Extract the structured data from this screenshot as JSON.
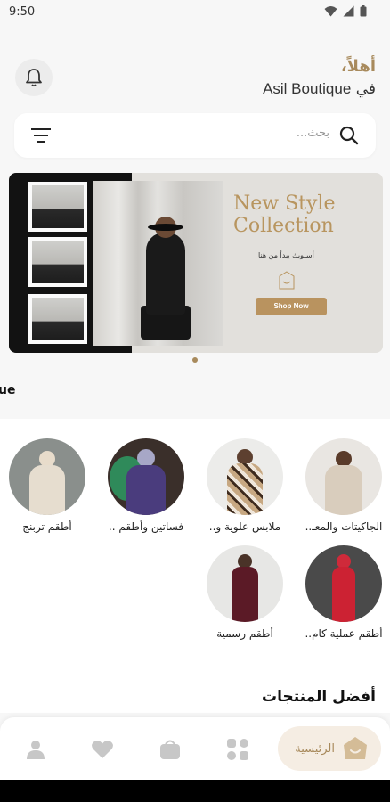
{
  "status_bar": {
    "time": "9:50"
  },
  "header": {
    "greeting": "أهلاً،",
    "boutique_prefix": "في",
    "boutique_name": "Asil Boutique"
  },
  "search": {
    "placeholder": "بحث..."
  },
  "banner": {
    "title_line1": "New Style",
    "title_line2": "Collection",
    "subtitle": "أسلوبك يبدأ من هنا",
    "cta": "Shop Now"
  },
  "section_cut_text": "ue",
  "categories": [
    {
      "label": "الجاكيتات والمعـ.."
    },
    {
      "label": "ملابس علوية و.."
    },
    {
      "label": "فساتين وأطقم .."
    },
    {
      "label": "أطقم تربنج"
    },
    {
      "label": "أطقم عملية كام.."
    },
    {
      "label": "أطقم رسمية"
    }
  ],
  "best_products_title": "أفضل المنتجات",
  "bottom_nav": {
    "home_label": "الرئيسية",
    "items": [
      "home-icon",
      "grid-icon",
      "basket-icon",
      "heart-icon",
      "profile-icon"
    ]
  },
  "colors": {
    "accent": "#a88a5c",
    "background": "#f7f7f7",
    "home_pill": "#f5ede3"
  }
}
